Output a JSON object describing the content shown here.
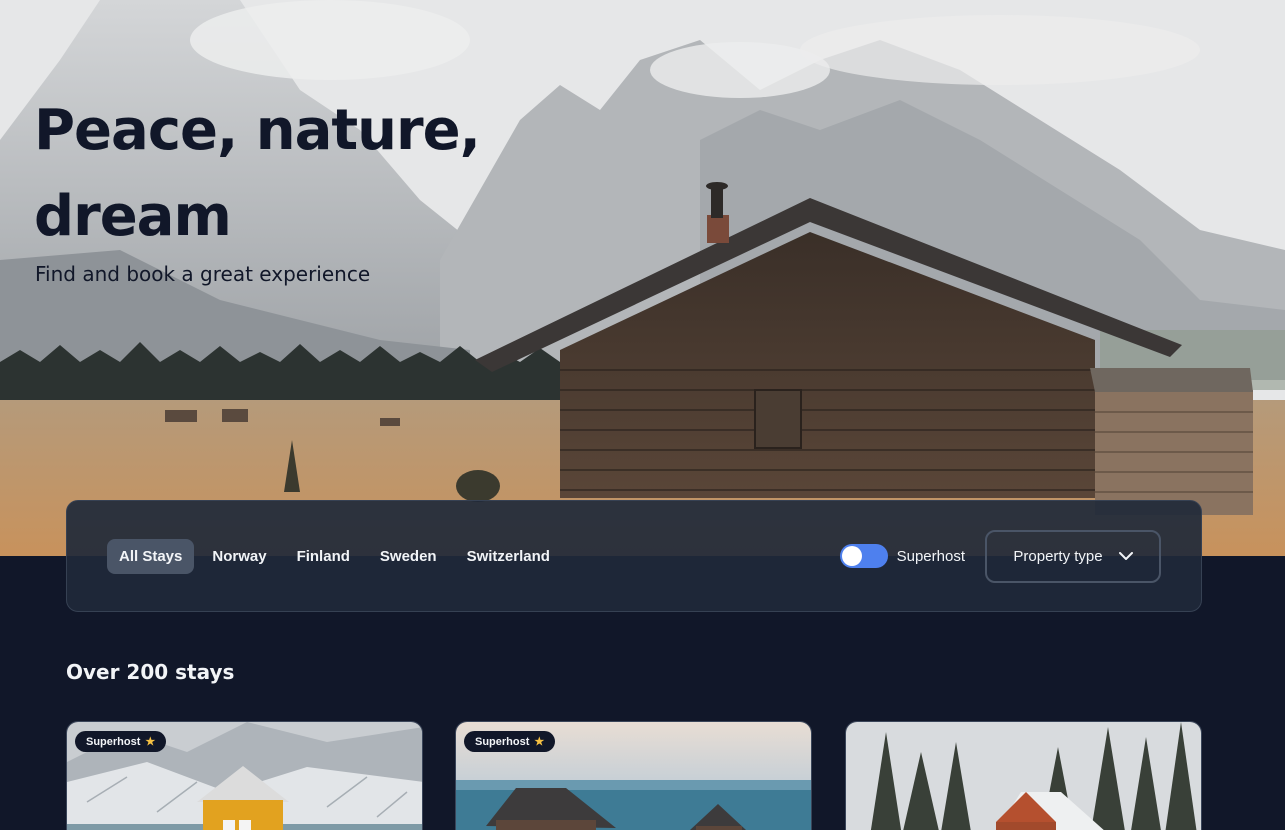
{
  "hero": {
    "title": "Peace, nature, dream",
    "subtitle": "Find and book a great experience"
  },
  "filters": {
    "tabs": [
      {
        "label": "All Stays",
        "active": true
      },
      {
        "label": "Norway",
        "active": false
      },
      {
        "label": "Finland",
        "active": false
      },
      {
        "label": "Sweden",
        "active": false
      },
      {
        "label": "Switzerland",
        "active": false
      }
    ],
    "superhost": {
      "label": "Superhost",
      "enabled": true
    },
    "property_type": {
      "label": "Property type",
      "icon": "chevron-down-icon"
    }
  },
  "listing": {
    "title": "Over 200 stays",
    "cards": [
      {
        "badge": "Superhost",
        "badge_icon": "star-icon"
      },
      {
        "badge": "Superhost",
        "badge_icon": "star-icon"
      },
      {
        "badge": null
      }
    ]
  },
  "colors": {
    "background": "#111729",
    "accent": "#4e80ee",
    "star": "#f6c143"
  }
}
